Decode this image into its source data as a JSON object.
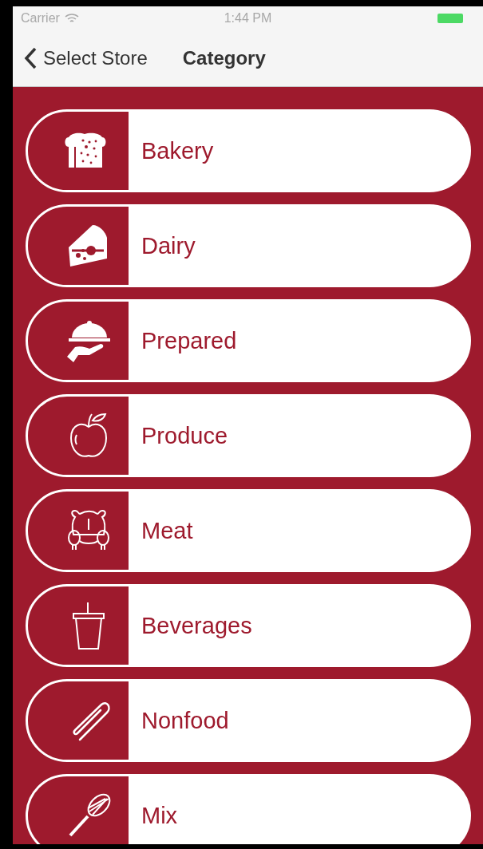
{
  "status_bar": {
    "carrier": "Carrier",
    "time": "1:44 PM"
  },
  "nav_bar": {
    "back_label": "Select Store",
    "title": "Category"
  },
  "categories": [
    {
      "label": "Bakery"
    },
    {
      "label": "Dairy"
    },
    {
      "label": "Prepared"
    },
    {
      "label": "Produce"
    },
    {
      "label": "Meat"
    },
    {
      "label": "Beverages"
    },
    {
      "label": "Nonfood"
    },
    {
      "label": "Mix"
    }
  ]
}
